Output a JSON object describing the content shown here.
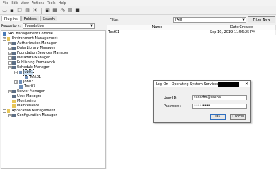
{
  "menu": [
    "File",
    "Edit",
    "View",
    "Actions",
    "Tools",
    "Help"
  ],
  "toolbar_icons": [
    "folder-open-icon",
    "save-icon",
    "copy-icon",
    "paste-icon",
    "delete-icon",
    "refresh-icon",
    "properties-icon",
    "history-icon",
    "grid-icon",
    "stop-icon"
  ],
  "left": {
    "tabs": [
      "Plug-ins",
      "Folders",
      "Search"
    ],
    "repository_label": "Repository:",
    "repository_value": "Foundation",
    "tree": [
      {
        "label": "SAS Management Console",
        "icon": "sas"
      },
      {
        "label": "Environment Management",
        "icon": "folder"
      },
      {
        "label": "Authorization Manager",
        "icon": "mgr"
      },
      {
        "label": "Data Library Manager",
        "icon": "mgr"
      },
      {
        "label": "Foundation Services Manager",
        "icon": "mgr"
      },
      {
        "label": "Metadata Manager",
        "icon": "mgr"
      },
      {
        "label": "Publishing Framework",
        "icon": "mgr"
      },
      {
        "label": "Schedule Manager",
        "icon": "mgr"
      },
      {
        "label": "Job01",
        "icon": "job"
      },
      {
        "label": "Test01",
        "icon": "job"
      },
      {
        "label": "Job02",
        "icon": "job"
      },
      {
        "label": "Test03",
        "icon": "job"
      },
      {
        "label": "Server Manager",
        "icon": "mgr"
      },
      {
        "label": "User Manager",
        "icon": "mgr"
      },
      {
        "label": "Monitoring",
        "icon": "folder"
      },
      {
        "label": "Maintenance",
        "icon": "folder"
      },
      {
        "label": "Application Management",
        "icon": "folder"
      },
      {
        "label": "Configuration Manager",
        "icon": "mgr"
      }
    ]
  },
  "right": {
    "filter_label": "Filter:",
    "filter_value": "[All]",
    "filter_button": "Filter Now",
    "columns": [
      "Name",
      "Date Created"
    ],
    "rows": [
      {
        "name": "Test01",
        "date": "Sep 10, 2019 11:56:25 PM"
      }
    ]
  },
  "dialog": {
    "title": "Log On - Operating System Services",
    "user_label": "User ID:",
    "user_value": "sasadm@saspw",
    "password_label": "Password:",
    "password_value": "••••••••",
    "ok": "OK",
    "cancel": "Cancel"
  }
}
